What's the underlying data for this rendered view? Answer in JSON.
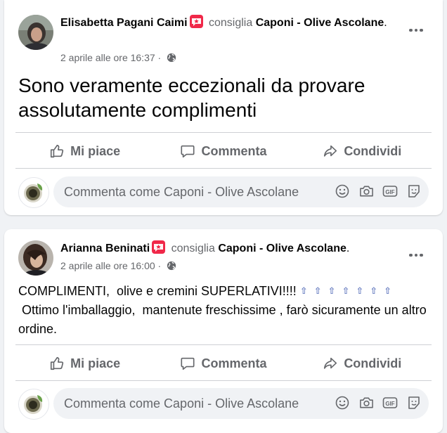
{
  "posts": [
    {
      "author": "Elisabetta Pagani Caimi",
      "verb": "consiglia",
      "page": "Caponi - Olive Ascolane",
      "punctuation": ".",
      "timestamp": "2 aprile alle ore 16:37",
      "separator": "·",
      "text": "Sono veramente eccezionali da provare assolutamente complimenti",
      "text_suffix": ""
    },
    {
      "author": "Arianna Beninati",
      "verb": "consiglia",
      "page": "Caponi - Olive Ascolane",
      "punctuation": ".",
      "timestamp": "2 aprile alle ore 16:00",
      "separator": "·",
      "text": "COMPLIMENTI,  olive e cremini SUPERLATIVI!!!! ",
      "emoji_row": "⇧⇧⇧⇧⇧⇧⇧",
      "text_suffix": " Ottimo l'imballaggio,  mantenute freschissime , farò sicuramente un altro ordine."
    }
  ],
  "actions": {
    "like": "Mi piace",
    "comment": "Commenta",
    "share": "Condividi"
  },
  "comment_placeholder": "Commenta come Caponi - Olive Ascolane",
  "icons": {
    "badge": "recommend-star-icon",
    "privacy": "globe-icon",
    "more": "more-dots-icon",
    "like": "thumbs-up-icon",
    "comment": "speech-bubble-icon",
    "share": "share-arrow-icon",
    "emoji": "smiley-icon",
    "camera": "camera-icon",
    "gif": "gif-icon",
    "sticker": "sticker-icon"
  },
  "colors": {
    "badge": "#f02849",
    "muted": "#65676b",
    "divider": "#ced0d4",
    "background": "#f0f2f5"
  }
}
